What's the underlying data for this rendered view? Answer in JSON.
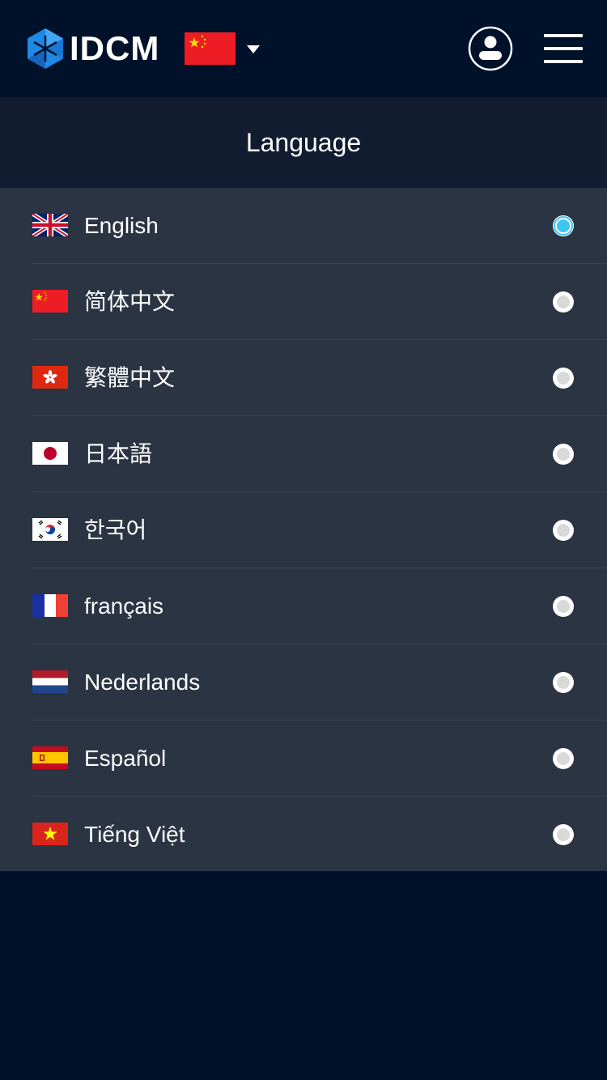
{
  "header": {
    "brand": "IDCM",
    "current_flag": "cn-flag-icon",
    "dropdown_icon": "caret-down-icon",
    "user_icon": "user-icon",
    "menu_icon": "hamburger-menu-icon"
  },
  "page": {
    "title": "Language"
  },
  "languages": [
    {
      "label": "English",
      "flag": "uk-flag-icon",
      "selected": true
    },
    {
      "label": "简体中文",
      "flag": "cn-flag-icon",
      "selected": false
    },
    {
      "label": "繁體中文",
      "flag": "hk-flag-icon",
      "selected": false
    },
    {
      "label": "日本語",
      "flag": "jp-flag-icon",
      "selected": false
    },
    {
      "label": "한국어",
      "flag": "kr-flag-icon",
      "selected": false
    },
    {
      "label": "français",
      "flag": "fr-flag-icon",
      "selected": false
    },
    {
      "label": "Nederlands",
      "flag": "nl-flag-icon",
      "selected": false
    },
    {
      "label": "Español",
      "flag": "es-flag-icon",
      "selected": false
    },
    {
      "label": "Tiếng Việt",
      "flag": "vn-flag-icon",
      "selected": false
    }
  ],
  "colors": {
    "background": "#00112a",
    "title_bar": "#111c31",
    "list_bg": "#2b3442",
    "radio_selected": "#3cc4f5",
    "radio_unselected": "#d9d9d9"
  }
}
